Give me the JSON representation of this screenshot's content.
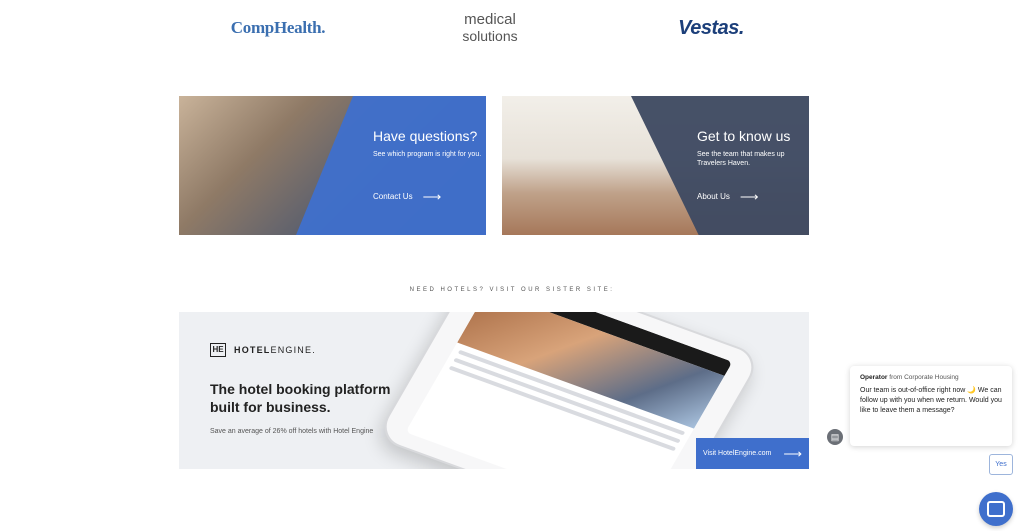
{
  "logos": {
    "comphealth": "CompHealth.",
    "medical_line1": "medical",
    "medical_line2": "solutions",
    "vestas": "Vestas."
  },
  "cards": [
    {
      "title": "Have questions?",
      "desc": "See which program is right for you.",
      "link": "Contact Us",
      "arrow": "⟶"
    },
    {
      "title": "Get to know us",
      "desc": "See the team that makes up Travelers Haven.",
      "link": "About Us",
      "arrow": "⟶"
    }
  ],
  "sister": {
    "label": "NEED HOTELS? VISIT OUR SISTER SITE:"
  },
  "hotel_engine": {
    "mark": "HE",
    "word_bold": "HOTEL",
    "word_rest": "ENGINE.",
    "title": "The hotel booking platform built for business.",
    "subtitle": "Save an average of 26% off hotels with Hotel Engine",
    "button": "Visit HotelEngine.com",
    "button_arrow": "⟶"
  },
  "chat": {
    "operator": "Operator",
    "from": "from Corporate Housing",
    "message": "Our team is out-of-office right now 🌙 We can follow up with you when we return. Would you like to leave them a message?",
    "yes": "Yes",
    "icon_glyph": "▤"
  },
  "colors": {
    "accent": "#3f6fcc",
    "dark_overlay": "#3e4a62",
    "banner_bg": "#eef0f3"
  }
}
